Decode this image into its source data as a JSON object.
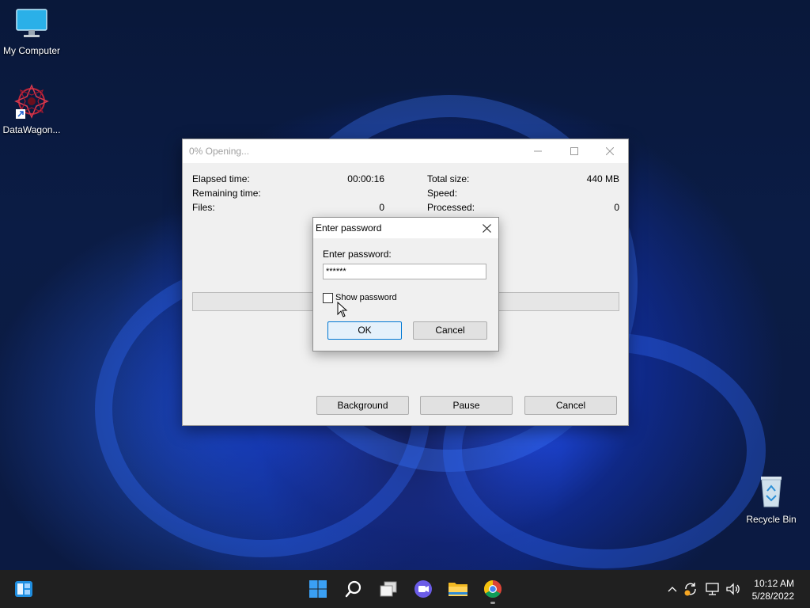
{
  "desktop": {
    "icons": [
      {
        "label": "My Computer"
      },
      {
        "label": "DataWagon..."
      },
      {
        "label": "Recycle Bin"
      }
    ]
  },
  "main_window": {
    "title": "0% Opening...",
    "stats_left": [
      {
        "label": "Elapsed time:",
        "value": "00:00:16"
      },
      {
        "label": "Remaining time:",
        "value": ""
      },
      {
        "label": "Files:",
        "value": "0"
      }
    ],
    "stats_right": [
      {
        "label": "Total size:",
        "value": "440 MB"
      },
      {
        "label": "Speed:",
        "value": ""
      },
      {
        "label": "Processed:",
        "value": "0"
      }
    ],
    "progress_percent": 0,
    "buttons": {
      "background": "Background",
      "pause": "Pause",
      "cancel": "Cancel"
    }
  },
  "password_dialog": {
    "title": "Enter password",
    "field_label": "Enter password:",
    "field_value": "******",
    "show_password_label": "Show password",
    "show_password_checked": false,
    "ok_label": "OK",
    "cancel_label": "Cancel"
  },
  "taskbar": {
    "time": "10:12 AM",
    "date": "5/28/2022",
    "apps": [
      "start-icon",
      "search-icon",
      "task-view-icon",
      "teams-chat-icon",
      "file-explorer-icon",
      "chrome-icon"
    ]
  },
  "colors": {
    "accent": "#0078d4",
    "taskbar": "#202020",
    "desktop_base": "#0b1c45"
  }
}
